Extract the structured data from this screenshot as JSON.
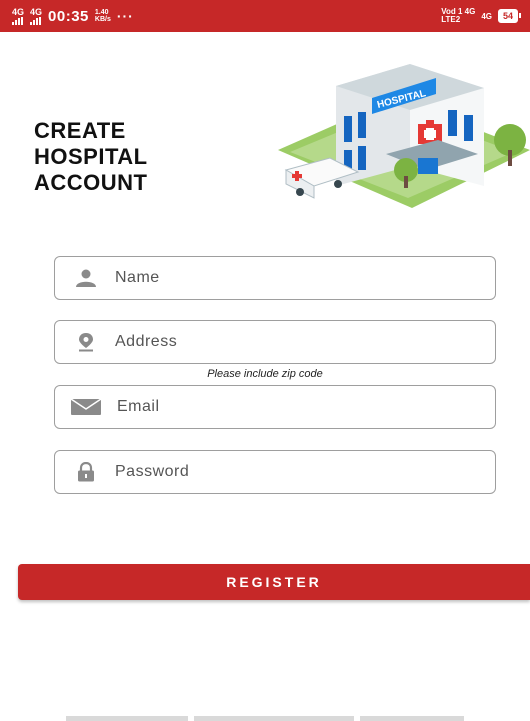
{
  "status_bar": {
    "net1": "4G",
    "net2": "4G",
    "time": "00:35",
    "speed_value": "1.40",
    "speed_unit": "KB/s",
    "more": "···",
    "carrier_top": "Vod 1 4G",
    "carrier_bottom": "LTE2",
    "net_right": "4G",
    "battery": "54"
  },
  "header": {
    "title_lines": [
      "CREATE",
      "HOSPITAL",
      "ACCOUNT"
    ],
    "illustration_text": "HOSPITAL"
  },
  "form": {
    "name_placeholder": "Name",
    "address_placeholder": "Address",
    "address_hint": "Please include zip code",
    "email_placeholder": "Email",
    "password_placeholder": "Password",
    "register_label": "REGISTER"
  },
  "colors": {
    "accent": "#c62828",
    "field_border": "#9e9e9e",
    "icon_gray": "#8a8a8a"
  }
}
